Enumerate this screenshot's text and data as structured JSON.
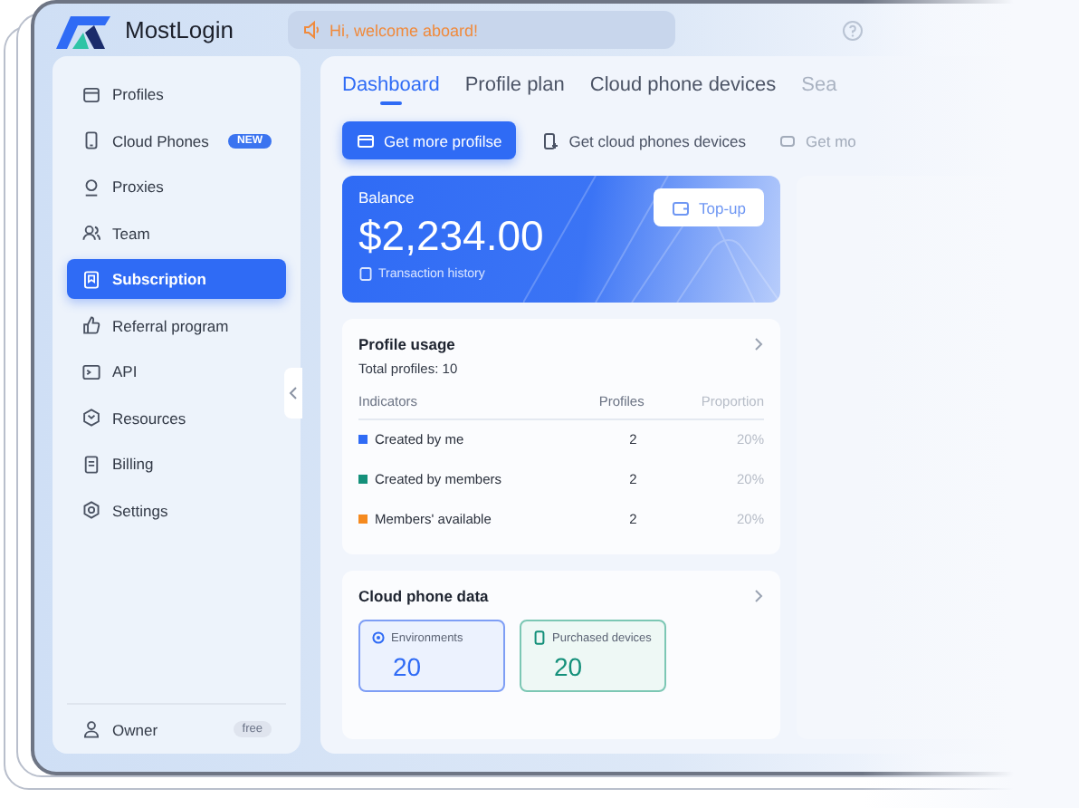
{
  "header": {
    "app_name": "MostLogin",
    "notice": "Hi, welcome aboard!"
  },
  "sidebar": {
    "items": [
      {
        "label": "Profiles",
        "selected": false
      },
      {
        "label": "Cloud Phones",
        "selected": false,
        "badge": "NEW"
      },
      {
        "label": "Proxies",
        "selected": false
      },
      {
        "label": "Team",
        "selected": false
      },
      {
        "label": "Subscription",
        "selected": true
      },
      {
        "label": "Referral program",
        "selected": false
      },
      {
        "label": "API",
        "selected": false
      },
      {
        "label": "Resources",
        "selected": false
      },
      {
        "label": "Billing",
        "selected": false
      },
      {
        "label": "Settings",
        "selected": false
      }
    ],
    "footer": {
      "label": "Owner",
      "badge": "free"
    }
  },
  "tabs": [
    {
      "label": "Dashboard",
      "selected": true
    },
    {
      "label": "Profile plan",
      "selected": false
    },
    {
      "label": "Cloud phone devices",
      "selected": false
    },
    {
      "label": "Sea",
      "selected": false
    }
  ],
  "actions": [
    {
      "label": "Get more profilse",
      "kind": "primary"
    },
    {
      "label": "Get cloud phones devices",
      "kind": "plain"
    },
    {
      "label": "Get mo",
      "kind": "faded"
    }
  ],
  "balance": {
    "title": "Balance",
    "amount": "$2,234.00",
    "history": "Transaction history",
    "button": "Top-up"
  },
  "profile_usage": {
    "title": "Profile usage",
    "total": "Total profiles: 10",
    "columns": [
      "Indicators",
      "Profiles",
      "Proportion"
    ],
    "rows": [
      {
        "indicator": "Created by me",
        "profiles": "2",
        "proportion": "20%",
        "color": "#2f6bf5"
      },
      {
        "indicator": "Created by members",
        "profiles": "2",
        "proportion": "20%",
        "color": "#14907a"
      },
      {
        "indicator": "Members' available",
        "profiles": "2",
        "proportion": "20%",
        "color": "#f58a1f"
      }
    ]
  },
  "cloud_phone_data": {
    "title": "Cloud phone data",
    "stats": [
      {
        "label": "Environments",
        "value": "20",
        "kind": "environments"
      },
      {
        "label": "Purchased devices",
        "value": "20",
        "kind": "devices"
      }
    ]
  }
}
